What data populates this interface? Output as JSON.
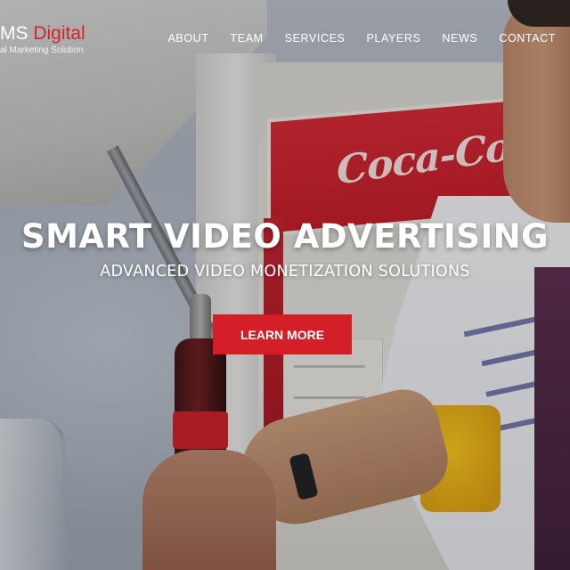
{
  "brand": {
    "name_prefix": "MS ",
    "name_accent": "Digital",
    "tagline": "al Marketing Solution",
    "accent_color": "#d8212c"
  },
  "nav": {
    "items": [
      "ABOUT",
      "TEAM",
      "SERVICES",
      "PLAYERS",
      "NEWS",
      "CONTACT"
    ]
  },
  "hero": {
    "title": "SMART VIDEO ADVERTISING",
    "subtitle": "ADVANCED VIDEO MONETIZATION SOLUTIONS",
    "cta_label": "LEARN MORE",
    "cta_color": "#d51f28",
    "sign_text": "Coca-Cola"
  }
}
